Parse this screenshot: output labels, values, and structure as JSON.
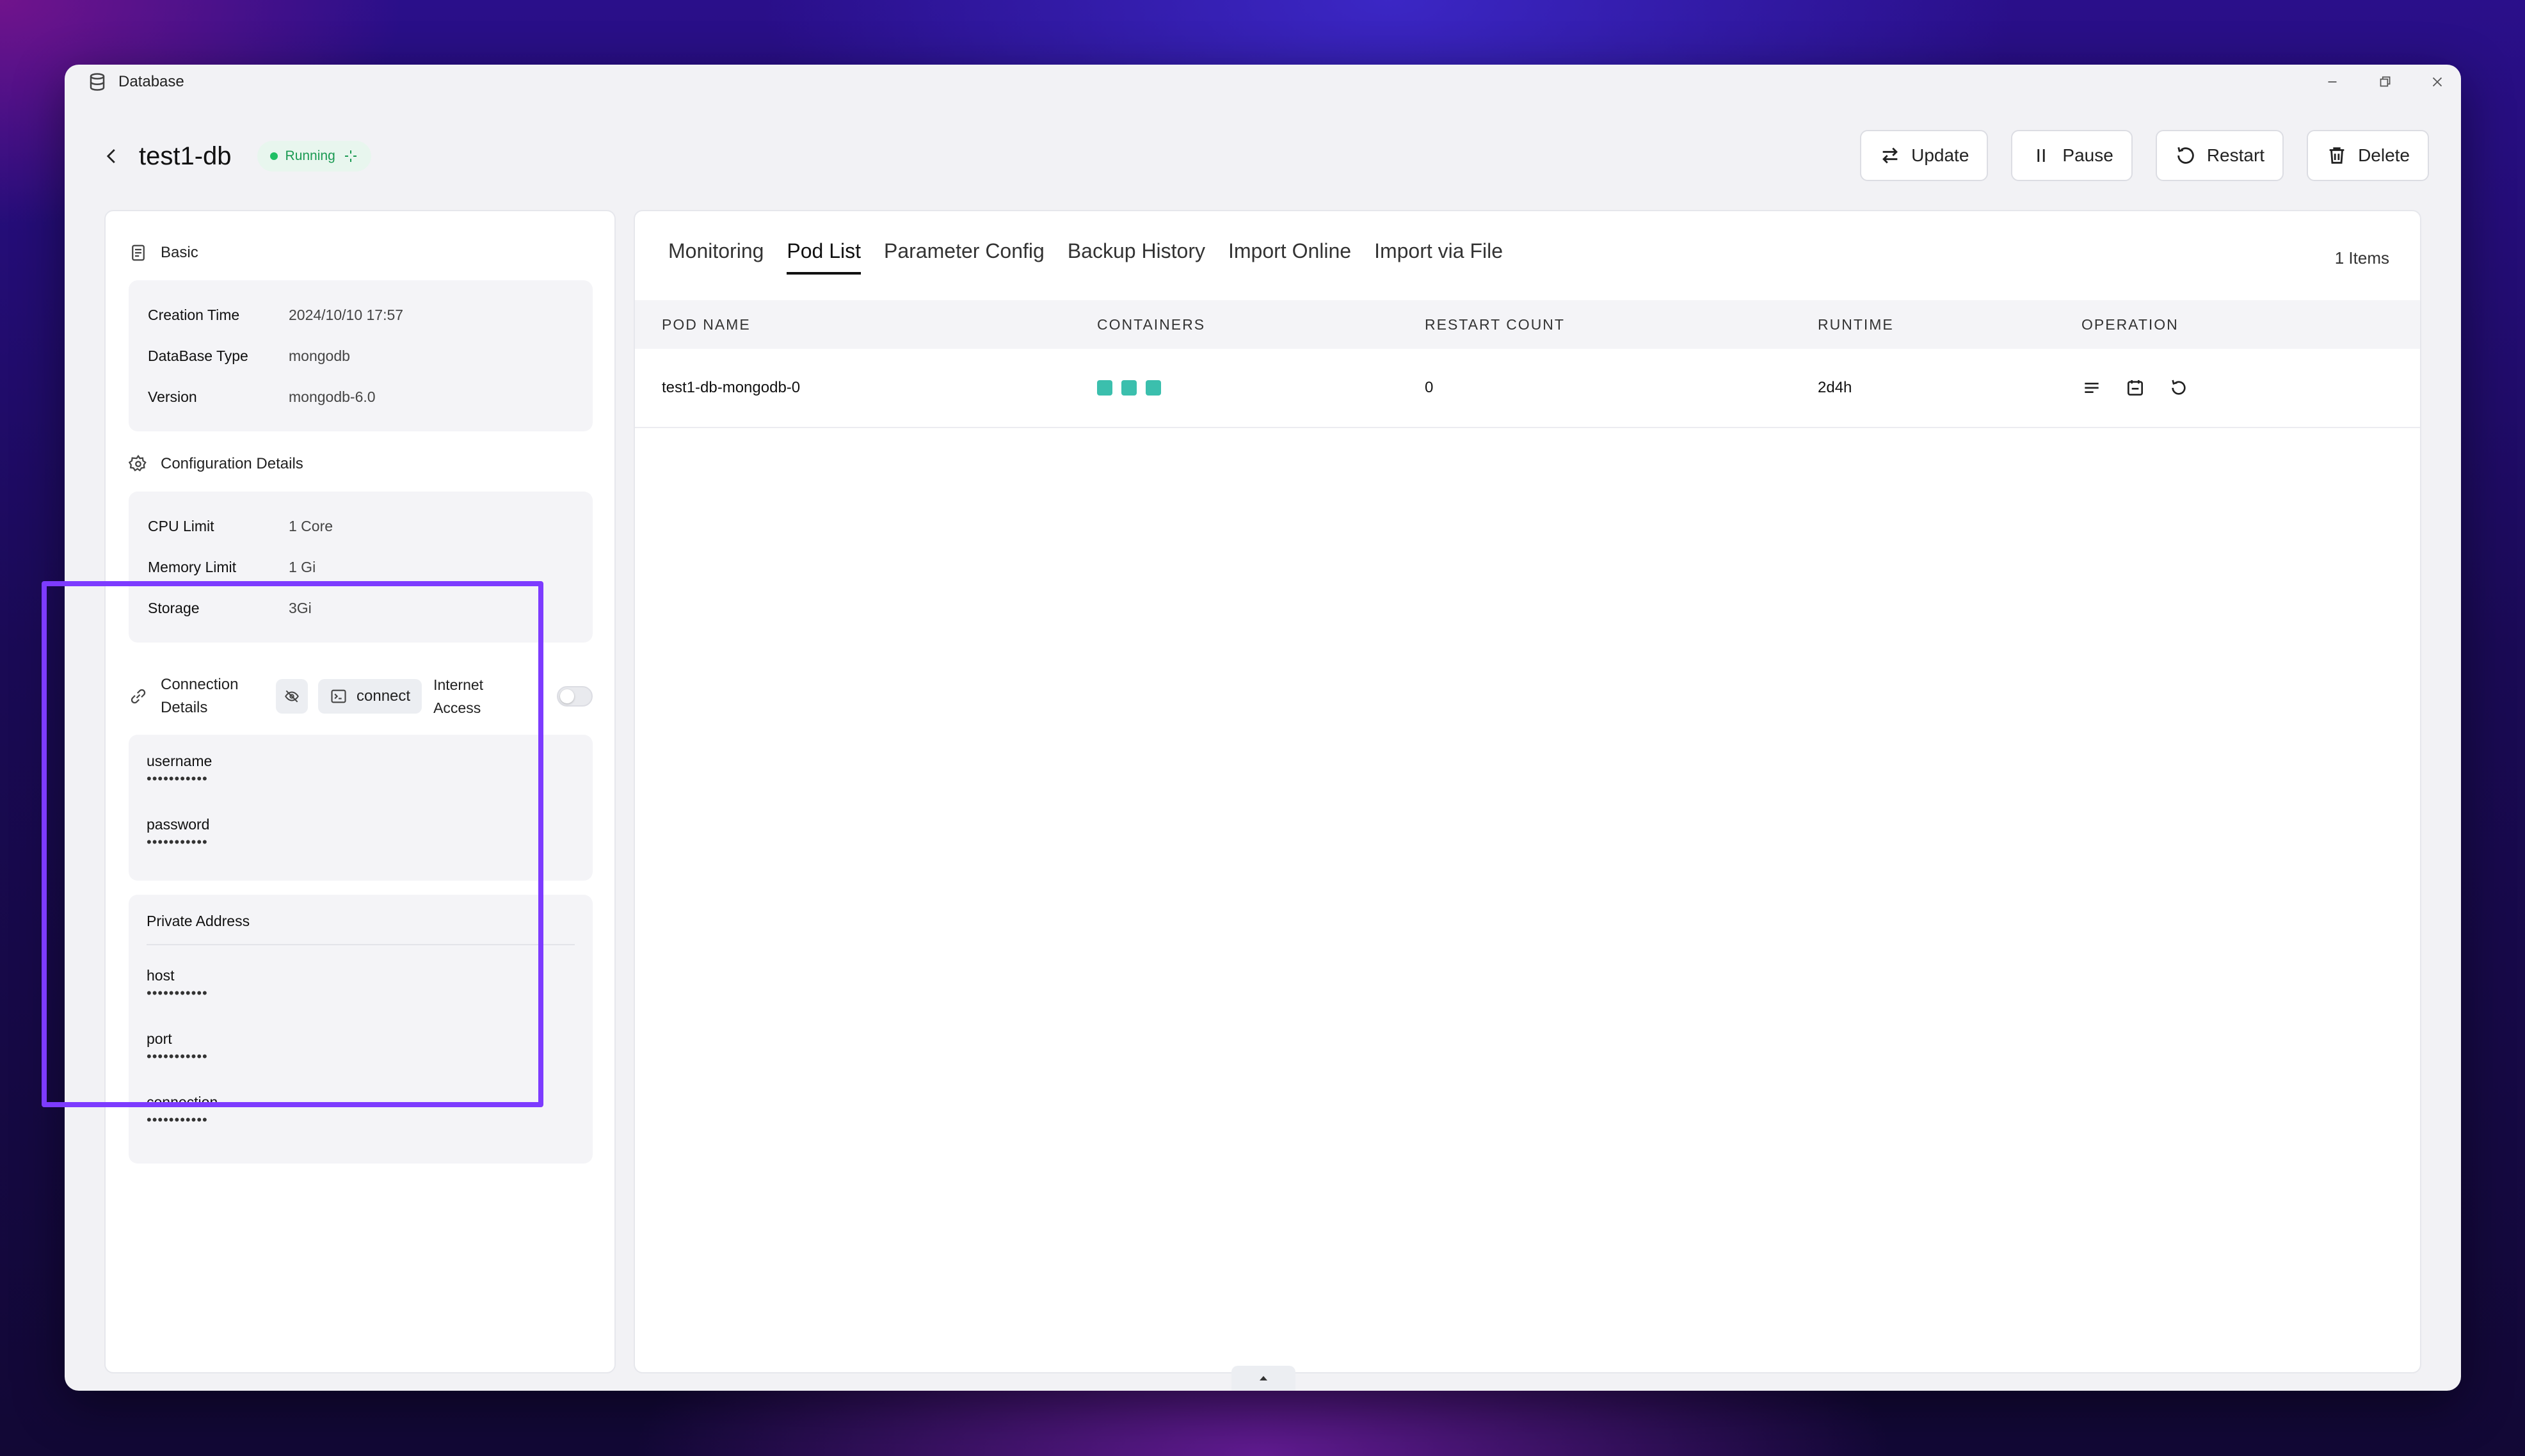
{
  "window": {
    "title": "Database"
  },
  "header": {
    "title": "test1-db",
    "status": "Running",
    "actions": {
      "update": "Update",
      "pause": "Pause",
      "restart": "Restart",
      "delete": "Delete"
    }
  },
  "basic": {
    "title": "Basic",
    "rows": [
      {
        "label": "Creation Time",
        "value": "2024/10/10 17:57"
      },
      {
        "label": "DataBase Type",
        "value": "mongodb"
      },
      {
        "label": "Version",
        "value": "mongodb-6.0"
      }
    ]
  },
  "config": {
    "title": "Configuration Details",
    "rows": [
      {
        "label": "CPU Limit",
        "value": "1 Core"
      },
      {
        "label": "Memory Limit",
        "value": "1 Gi"
      },
      {
        "label": "Storage",
        "value": "3Gi"
      }
    ]
  },
  "connection": {
    "title": "Connection Details",
    "connect_label": "connect",
    "internet_label": "Internet Access",
    "internet_enabled": false,
    "username": {
      "label": "username",
      "value": "•••••••••••"
    },
    "password": {
      "label": "password",
      "value": "•••••••••••"
    },
    "private_address": {
      "title": "Private Address",
      "host": {
        "label": "host",
        "value": "•••••••••••"
      },
      "port": {
        "label": "port",
        "value": "•••••••••••"
      },
      "connection": {
        "label": "connection",
        "value": "•••••••••••"
      }
    }
  },
  "tabs": [
    "Monitoring",
    "Pod List",
    "Parameter Config",
    "Backup History",
    "Import Online",
    "Import via File"
  ],
  "active_tab": "Pod List",
  "items_count": "1 Items",
  "table": {
    "headers": {
      "name": "POD NAME",
      "containers": "CONTAINERS",
      "restart": "RESTART COUNT",
      "runtime": "RUNTIME",
      "operation": "OPERATION"
    },
    "rows": [
      {
        "name": "test1-db-mongodb-0",
        "containers": 3,
        "restart": "0",
        "runtime": "2d4h"
      }
    ]
  },
  "colors": {
    "running": "#1fbf64",
    "container": "#3bbfad",
    "highlight": "#7d3bff"
  },
  "icons": [
    "database-icon",
    "minimize-icon",
    "restore-icon",
    "close-icon",
    "back-icon",
    "sparkle-icon",
    "swap-icon",
    "pause-icon",
    "restart-icon",
    "trash-icon",
    "document-icon",
    "gear-icon",
    "link-icon",
    "eye-off-icon",
    "terminal-icon",
    "log-icon",
    "calendar-icon",
    "refresh-icon",
    "chevron-up-icon"
  ]
}
